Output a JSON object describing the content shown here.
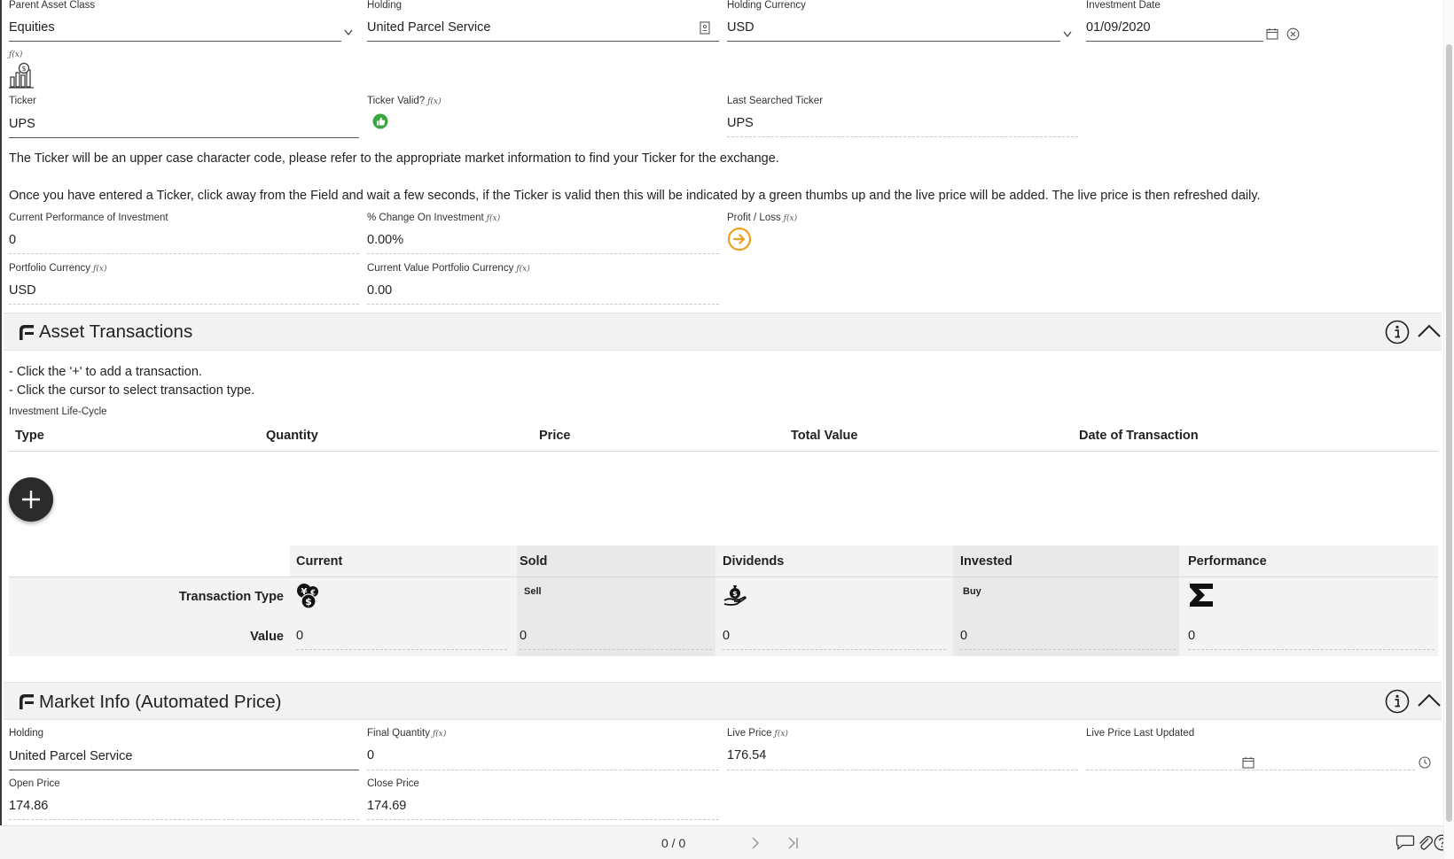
{
  "fields_top": {
    "parent_asset_class": {
      "label": "Parent Asset Class",
      "value": "Equities"
    },
    "holding": {
      "label": "Holding",
      "value": "United Parcel Service"
    },
    "holding_currency": {
      "label": "Holding Currency",
      "value": "USD"
    },
    "investment_date": {
      "label": "Investment Date",
      "value": "01/09/2020"
    }
  },
  "fx_symbol": "ƒ(x)",
  "ticker": {
    "label": "Ticker",
    "value": "UPS"
  },
  "ticker_valid": {
    "label": "Ticker Valid?"
  },
  "last_searched": {
    "label": "Last Searched Ticker",
    "value": "UPS"
  },
  "info_text_1": "The Ticker will be an upper case character code, please refer to the appropriate market information to find your Ticker for the exchange.",
  "info_text_2": "Once you have entered a Ticker, click away from the Field and wait a few seconds, if the Ticker is valid then this will be indicated by a green thumbs up and the live price will be added. The live price is then refreshed daily.",
  "performance": {
    "current_performance": {
      "label": "Current Performance of Investment",
      "value": "0"
    },
    "pct_change": {
      "label": "% Change On Investment",
      "value": "0.00%"
    },
    "profit_loss": {
      "label": "Profit / Loss"
    },
    "portfolio_currency": {
      "label": "Portfolio Currency",
      "value": "USD"
    },
    "current_value_portfolio": {
      "label": "Current Value Portfolio Currency",
      "value": "0.00"
    }
  },
  "asset_transactions": {
    "title": "Asset Transactions",
    "hint_1": "- Click the '+' to add a transaction.",
    "hint_2": "- Click the cursor to select transaction type.",
    "lifecycle_label": "Investment Life-Cycle",
    "columns": [
      "Type",
      "Quantity",
      "Price",
      "Total Value",
      "Date of Transaction"
    ]
  },
  "summary": {
    "columns": [
      "Current",
      "Sold",
      "Dividends",
      "Invested",
      "Performance"
    ],
    "row_type_label": "Transaction Type",
    "row_value_label": "Value",
    "type_texts": {
      "sold": "Sell",
      "invested": "Buy"
    },
    "values": [
      "0",
      "0",
      "0",
      "0",
      "0"
    ]
  },
  "market_info": {
    "title": "Market Info (Automated Price)",
    "holding": {
      "label": "Holding",
      "value": "United Parcel Service"
    },
    "final_quantity": {
      "label": "Final Quantity",
      "value": "0"
    },
    "live_price": {
      "label": "Live Price",
      "value": "176.54"
    },
    "live_price_updated": {
      "label": "Live Price Last Updated",
      "value": ""
    },
    "open_price": {
      "label": "Open Price",
      "value": "174.86"
    },
    "close_price": {
      "label": "Close Price",
      "value": "174.69"
    }
  },
  "footer": {
    "pager": "0 / 0"
  },
  "colors": {
    "thumbs_green": "#3aa640",
    "profit_orange": "#f0a020",
    "section_bg": "#f2f2f2"
  }
}
